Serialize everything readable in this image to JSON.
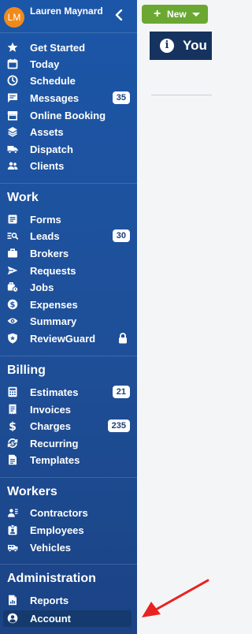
{
  "user": {
    "initials": "LM",
    "name": "Lauren Maynard"
  },
  "nav_top": [
    {
      "label": "Get Started",
      "icon": "star-icon"
    },
    {
      "label": "Today",
      "icon": "calendar-icon"
    },
    {
      "label": "Schedule",
      "icon": "clock-icon"
    },
    {
      "label": "Messages",
      "icon": "message-icon",
      "badge": "35"
    },
    {
      "label": "Online Booking",
      "icon": "store-icon"
    },
    {
      "label": "Assets",
      "icon": "layers-icon"
    },
    {
      "label": "Dispatch",
      "icon": "truck-icon"
    },
    {
      "label": "Clients",
      "icon": "users-icon"
    }
  ],
  "sections": {
    "work": {
      "title": "Work",
      "items": [
        {
          "label": "Forms",
          "icon": "form-icon"
        },
        {
          "label": "Leads",
          "icon": "search-list-icon",
          "badge": "30"
        },
        {
          "label": "Brokers",
          "icon": "briefcase-icon"
        },
        {
          "label": "Requests",
          "icon": "send-icon"
        },
        {
          "label": "Jobs",
          "icon": "briefcase-clock-icon"
        },
        {
          "label": "Expenses",
          "icon": "dollar-circle-icon"
        },
        {
          "label": "Summary",
          "icon": "eye-icon"
        },
        {
          "label": "ReviewGuard",
          "icon": "shield-star-icon",
          "locked": true
        }
      ]
    },
    "billing": {
      "title": "Billing",
      "items": [
        {
          "label": "Estimates",
          "icon": "calculator-icon",
          "badge": "21"
        },
        {
          "label": "Invoices",
          "icon": "receipt-icon"
        },
        {
          "label": "Charges",
          "icon": "dollar-icon",
          "badge": "235"
        },
        {
          "label": "Recurring",
          "icon": "recurring-icon"
        },
        {
          "label": "Templates",
          "icon": "template-icon"
        }
      ]
    },
    "workers": {
      "title": "Workers",
      "items": [
        {
          "label": "Contractors",
          "icon": "contractor-icon"
        },
        {
          "label": "Employees",
          "icon": "id-badge-icon"
        },
        {
          "label": "Vehicles",
          "icon": "vehicle-icon"
        }
      ]
    },
    "administration": {
      "title": "Administration",
      "items": [
        {
          "label": "Reports",
          "icon": "report-icon"
        },
        {
          "label": "Account",
          "icon": "user-circle-icon",
          "active": true
        }
      ]
    }
  },
  "toolbar": {
    "new_label": "New"
  },
  "banner": {
    "text": "You"
  },
  "colors": {
    "sidebar": "#1c56a8",
    "new_button": "#6aa832",
    "banner": "#16335f",
    "arrow": "#e8231f",
    "avatar": "#f08a1c"
  }
}
